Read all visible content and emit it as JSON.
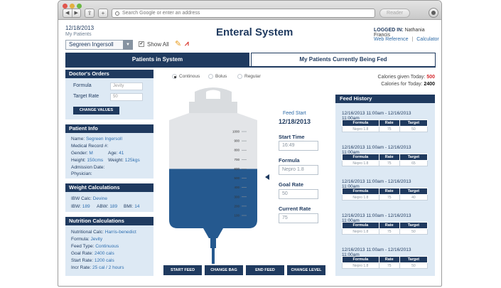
{
  "browser": {
    "back_glyph": "◀",
    "forward_glyph": "▶",
    "address_placeholder": "Search Google or enter an address",
    "reader_label": "Reader"
  },
  "header": {
    "date": "12/18/2013",
    "my_patients": "My Patients",
    "title": "Enteral System",
    "logged_in_label": "LOGGED IN:",
    "user_name": "Nathania Francis",
    "web_reference": "Web Reference",
    "separator": "|",
    "calculator": "Calculator",
    "selected_patient": "Segreen Ingersoll",
    "show_all": "Show All"
  },
  "tabs": {
    "patients_in_system": "Patients in System",
    "currently_fed": "My Patients Currently Being Fed"
  },
  "doctors_orders": {
    "heading": "Doctor's Orders",
    "formula_label": "Formula",
    "formula_value": "Jevity",
    "target_rate_label": "Target Rate",
    "target_rate_value": "50",
    "change_values": "CHANGE VALUES"
  },
  "patient_info": {
    "heading": "Patient Info",
    "name_label": "Name:",
    "name_value": "Segreen Ingersoll",
    "record_label": "Medical Record #:",
    "gender_label": "Gender:",
    "gender_value": "M",
    "age_label": "Age:",
    "age_value": "41",
    "height_label": "Height:",
    "height_value": "150cms",
    "weight_label": "Weight:",
    "weight_value": "125kgs",
    "admission_label": "Admission Date:",
    "physician_label": "Physician:"
  },
  "weight_calc": {
    "heading": "Weight Calculations",
    "ibw_calc_label": "IBW Calc:",
    "ibw_calc_value": "Devine",
    "ibw_label": "IBW:",
    "ibw_value": "189",
    "abw_label": "ABW:",
    "abw_value": "189",
    "bmi_label": "BMI:",
    "bmi_value": "14"
  },
  "nutrition_calc": {
    "heading": "Nutrition Calculations",
    "calc_label": "Nutritional Calc:",
    "calc_value": "Harris-benedict",
    "formula_label": "Formula:",
    "formula_value": "Jevity",
    "feed_type_label": "Feed Type:",
    "feed_type_value": "Continuous",
    "goal_rate_label": "Goal Rate:",
    "goal_rate_value": "2400 cals",
    "start_rate_label": "Start Rate:",
    "start_rate_value": "1200 cals",
    "incr_rate_label": "Incr Rate:",
    "incr_rate_value": "25 cal / 2 hours"
  },
  "feed_modes": [
    "Continous",
    "Bolus",
    "Regular"
  ],
  "calories": {
    "given_label": "Calories given Today:",
    "given_value": "500",
    "for_label": "Calories for Today:",
    "for_value": "2400"
  },
  "bag": {
    "fill_fraction": 0.5,
    "ticks": [
      "1000",
      "900",
      "800",
      "700",
      "600",
      "500",
      "400",
      "300",
      "200",
      "100"
    ]
  },
  "feed_start": {
    "label": "Feed Start",
    "date": "12/18/2013",
    "start_time_label": "Start Time",
    "start_time_value": "16:49",
    "formula_label": "Formula",
    "formula_value": "Nepro 1.8",
    "goal_rate_label": "Goal Rate",
    "goal_rate_value": "50",
    "current_rate_label": "Current Rate",
    "current_rate_value": "75"
  },
  "actions": {
    "start_feed": "START FEED",
    "change_bag": "CHANGE BAG",
    "end_feed": "END FEED",
    "change_level": "CHANGE LEVEL"
  },
  "feed_history": {
    "heading": "Feed History",
    "columns": [
      "Formula",
      "Rate",
      "Target"
    ],
    "entries": [
      {
        "time": "12/16/2013 11:00am - 12/16/2013 11:00am",
        "formula": "Nepro 1.8",
        "rate": "75",
        "target": "50"
      },
      {
        "time": "12/16/2013 11:00am - 12/16/2013 11:00am",
        "formula": "Nepro 1.8",
        "rate": "75",
        "target": "65"
      },
      {
        "time": "12/16/2013 11:00am - 12/16/2013 11:00am",
        "formula": "Nepro 1.8",
        "rate": "75",
        "target": "40"
      },
      {
        "time": "12/16/2013 11:00am - 12/16/2013 11:00am",
        "formula": "Nepro 1.8",
        "rate": "75",
        "target": "50"
      },
      {
        "time": "12/16/2013 11:00am - 12/16/2013 11:00am",
        "formula": "Nepro 1.8",
        "rate": "75",
        "target": "50"
      }
    ]
  },
  "colors": {
    "navy": "#1f3a5f",
    "panel": "#dde9f4",
    "fluid": "#25598f",
    "bag": "#e3e5e8",
    "alert": "#d4262b"
  }
}
